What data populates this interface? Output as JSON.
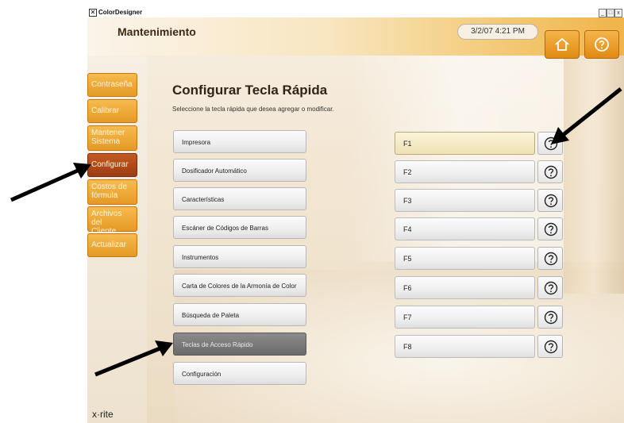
{
  "window": {
    "title": "ColorDesigner",
    "icon": "app-x-icon",
    "controls": [
      "_",
      "□",
      "x"
    ]
  },
  "header": {
    "title": "Mantenimiento",
    "datetime": "3/2/07 4:21 PM",
    "home_icon": "home-icon",
    "help_icon": "help-icon"
  },
  "sidebar": {
    "items": [
      {
        "label": "Contraseña"
      },
      {
        "label": "Calibrar"
      },
      {
        "label": "Mantener\nSistema"
      },
      {
        "label": "Configurar"
      },
      {
        "label": "Costos de\nfórmula"
      },
      {
        "label": "Archivos del\nCliente"
      },
      {
        "label": "Actualizar"
      }
    ],
    "active": "Configurar",
    "logo": "x·rite"
  },
  "main": {
    "title": "Configurar Tecla Rápida",
    "subtitle": "Seleccione la tecla rápida que desea agregar o modificar.",
    "functions": [
      {
        "label": "Impresora"
      },
      {
        "label": "Dosificador Automático"
      },
      {
        "label": "Características"
      },
      {
        "label": "Escáner de Códigos de Barras"
      },
      {
        "label": "Instrumentos"
      },
      {
        "label": "Carta de Colores de la Armonía de Color"
      },
      {
        "label": "Búsqueda de Paleta"
      },
      {
        "label": "Teclas de Acceso Rápido"
      },
      {
        "label": "Configuración"
      }
    ],
    "selected_function": "Teclas de Acceso Rápido",
    "keys": [
      {
        "label": "F1"
      },
      {
        "label": "F2"
      },
      {
        "label": "F3"
      },
      {
        "label": "F4"
      },
      {
        "label": "F5"
      },
      {
        "label": "F6"
      },
      {
        "label": "F7"
      },
      {
        "label": "F8"
      }
    ],
    "selected_key": "F1",
    "help_icon": "question-circle-icon"
  },
  "colors": {
    "accent_orange": "#e59a24",
    "active_nav": "#9c3c12",
    "selected_function": "#6a6a6a",
    "selected_key": "#efe2b7"
  }
}
